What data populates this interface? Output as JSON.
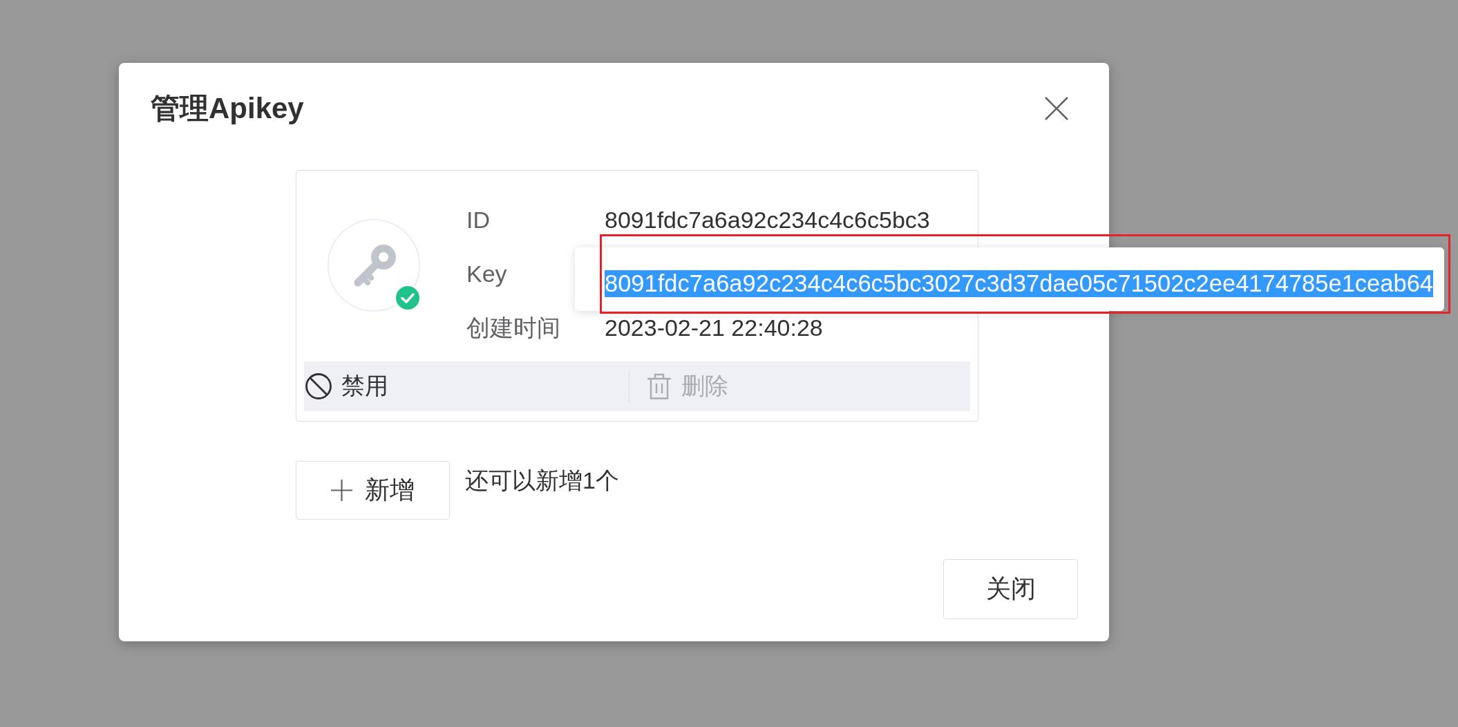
{
  "dialog": {
    "title": "管理Apikey"
  },
  "key_card": {
    "enabled": true,
    "fields": [
      {
        "label": "ID",
        "value": "8091fdc7a6a92c234c4c6c5bc3"
      },
      {
        "label": "Key",
        "tooltip": {
          "text": "8091fdc7a6a92c234c4c6c5bc3027c3d37dae05c71502c2ee4174785e1ceab64",
          "selected": true
        }
      },
      {
        "label": "创建时间",
        "value": "2023-02-21 22:40:28"
      }
    ],
    "actions": [
      {
        "kind": "disable",
        "label": "禁用",
        "disabled": false
      },
      {
        "kind": "delete",
        "label": "删除",
        "disabled": true
      }
    ]
  },
  "add_button": {
    "label": "新增"
  },
  "remaining_note": "还可以新增1个",
  "footer": {
    "buttons": [
      {
        "label": "关闭"
      }
    ]
  }
}
